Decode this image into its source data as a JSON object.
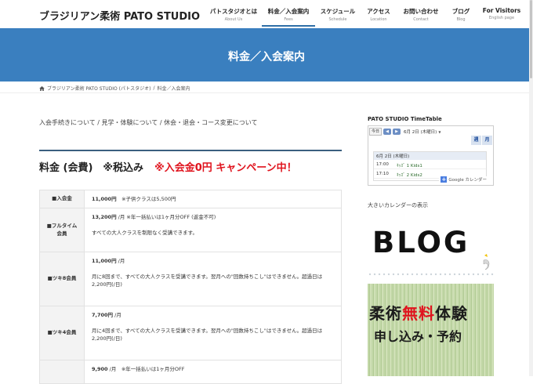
{
  "site": {
    "logo": "ブラジリアン柔術 PATO STUDIO"
  },
  "nav": [
    {
      "label": "パトスタジオとは",
      "sub": "About Us"
    },
    {
      "label": "料金／入会案内",
      "sub": "Fees"
    },
    {
      "label": "スケジュール",
      "sub": "Schedule"
    },
    {
      "label": "アクセス",
      "sub": "Location"
    },
    {
      "label": "お問い合わせ",
      "sub": "Contact"
    },
    {
      "label": "ブログ",
      "sub": "Blog"
    },
    {
      "label": "For Visitors",
      "sub": "English page"
    }
  ],
  "banner": {
    "title": "料金／入会案内"
  },
  "breadcrumb": {
    "home": "ブラジリアン柔術 PATO STUDIO (パトスタジオ)",
    "sep": "/",
    "current": "料金／入会案内"
  },
  "sublinks": [
    "入会手続きについて",
    "見学・体験について",
    "休会・退会・コース変更について"
  ],
  "sublinks_sep": " / ",
  "section": {
    "title": "料金 (会費)　※税込み",
    "campaign": "※入会金0円 キャンペーン中！"
  },
  "fees": [
    {
      "name": "■入会金",
      "price": "11,000円",
      "note": "　※子供クラスは5,500円",
      "desc": ""
    },
    {
      "name": "■フルタイム会員",
      "price": "13,200円",
      "note": " /月 ※年一括払いは1ヶ月分OFF (返金不可)",
      "desc": "すべての大人クラスを制限なく受講できます。"
    },
    {
      "name": "■ツキ8会員",
      "price": "11,000円",
      "note": " /月",
      "desc": "月に8回まで、すべての大人クラスを受講できます。翌月への\"回数持ちこし\"はできません。超過日は2,200円(/日)"
    },
    {
      "name": "■ツキ4会員",
      "price": "7,700円",
      "note": " /月",
      "desc": "月に4回まで、すべての大人クラスを受講できます。翌月への\"回数持ちこし\"はできません。超過日は2,200円(/日)"
    },
    {
      "name": "",
      "price": "9,900",
      "note": " /月　※年一括払いは1ヶ月分OFF",
      "desc": ""
    }
  ],
  "calendar": {
    "title": "PATO STUDIO TimeTable",
    "today": "今日",
    "prev": "◀",
    "next": "▶",
    "date": "6月 2日 (木曜日)",
    "dropdown": "▼",
    "tabs": [
      "週",
      "月"
    ],
    "day_header": "6月 2日 (木曜日)",
    "events": [
      {
        "time": "17:00",
        "name": "ｷｯｽﾞ 1 Kids1"
      },
      {
        "time": "17:10",
        "name": "ｷｯｽﾞ 2 Kids2"
      }
    ],
    "google_badge": "Google カレンダー",
    "big_link": "大きいカレンダーの表示"
  },
  "blog_banner": {
    "text": "BLOG"
  },
  "trial_banner": {
    "line1a": "柔術",
    "line1b": "無料",
    "line1c": "体験",
    "line2": "申し込み・予約"
  },
  "colors": {
    "brand": "#3a7fbf",
    "accent_red": "#e0141e"
  }
}
